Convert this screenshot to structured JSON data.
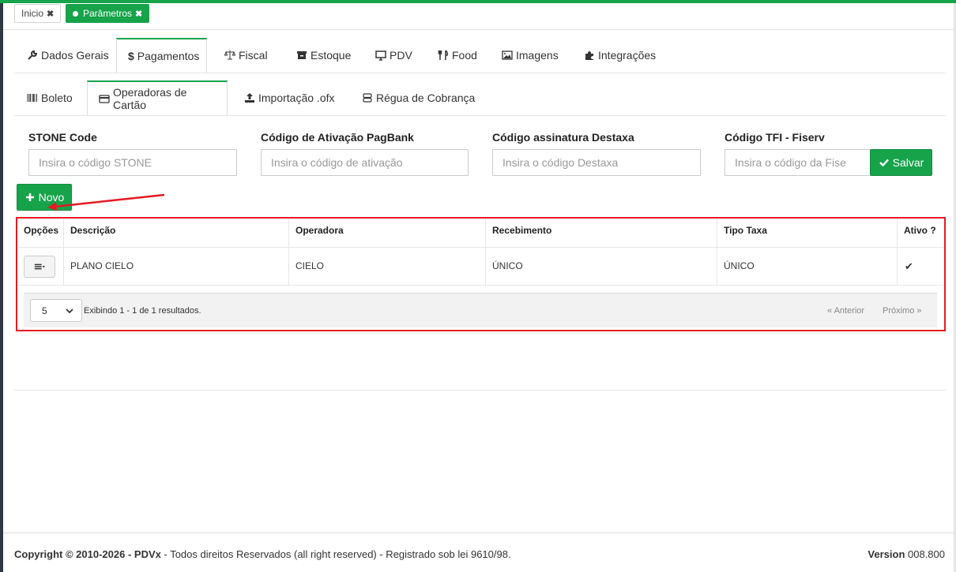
{
  "page_tabs": [
    {
      "label": "Inicio",
      "close": "✖"
    },
    {
      "label": "Parâmetros",
      "close": "✖"
    }
  ],
  "main_tabs": [
    {
      "label": "Dados Gerais",
      "icon": "wrench-icon"
    },
    {
      "label": "Pagamentos",
      "icon": "dollar-icon"
    },
    {
      "label": "Fiscal",
      "icon": "balance-scale-icon"
    },
    {
      "label": "Estoque",
      "icon": "archive-icon"
    },
    {
      "label": "PDV",
      "icon": "monitor-icon"
    },
    {
      "label": "Food",
      "icon": "utensils-icon"
    },
    {
      "label": "Imagens",
      "icon": "image-icon"
    },
    {
      "label": "Integrações",
      "icon": "puzzle-icon"
    }
  ],
  "sub_tabs": [
    {
      "label": "Boleto",
      "icon": "barcode-icon"
    },
    {
      "label": "Operadoras de Cartão",
      "icon": "credit-card-icon"
    },
    {
      "label": "Importação .ofx",
      "icon": "upload-icon"
    },
    {
      "label": "Régua de Cobrança",
      "icon": "server-icon"
    }
  ],
  "form": {
    "stone": {
      "label": "STONE Code",
      "placeholder": "Insira o código STONE"
    },
    "pagbank": {
      "label": "Código de Ativação PagBank",
      "placeholder": "Insira o código de ativação"
    },
    "destaxa": {
      "label": "Código assinatura Destaxa",
      "placeholder": "Insira o código Destaxa"
    },
    "fiserv": {
      "label": "Código TFI - Fiserv",
      "placeholder": "Insira o código da Fise"
    },
    "save_label": "Salvar"
  },
  "novo_label": "Novo",
  "table": {
    "headers": [
      "Opções",
      "Descrição",
      "Operadora",
      "Recebimento",
      "Tipo Taxa",
      "Ativo ?"
    ],
    "rows": [
      {
        "descricao": "PLANO CIELO",
        "operadora": "CIELO",
        "recebimento": "ÚNICO",
        "tipo_taxa": "ÚNICO",
        "ativo": "✔"
      }
    ],
    "page_size": "5",
    "info": "Exibindo 1 - 1 de 1 resultados.",
    "prev": "« Anterior",
    "next": "Próximo »"
  },
  "footer": {
    "copyright_prefix": "Copyright © 2010-2026 - ",
    "brand": "PDVx",
    "rest": " - Todos direitos Reservados (all right reserved) - Registrado sob lei 9610/98.",
    "version_label": "Version",
    "version_value": " 008.800"
  },
  "colors": {
    "accent": "#16a34a",
    "highlight": "#e31b23"
  }
}
